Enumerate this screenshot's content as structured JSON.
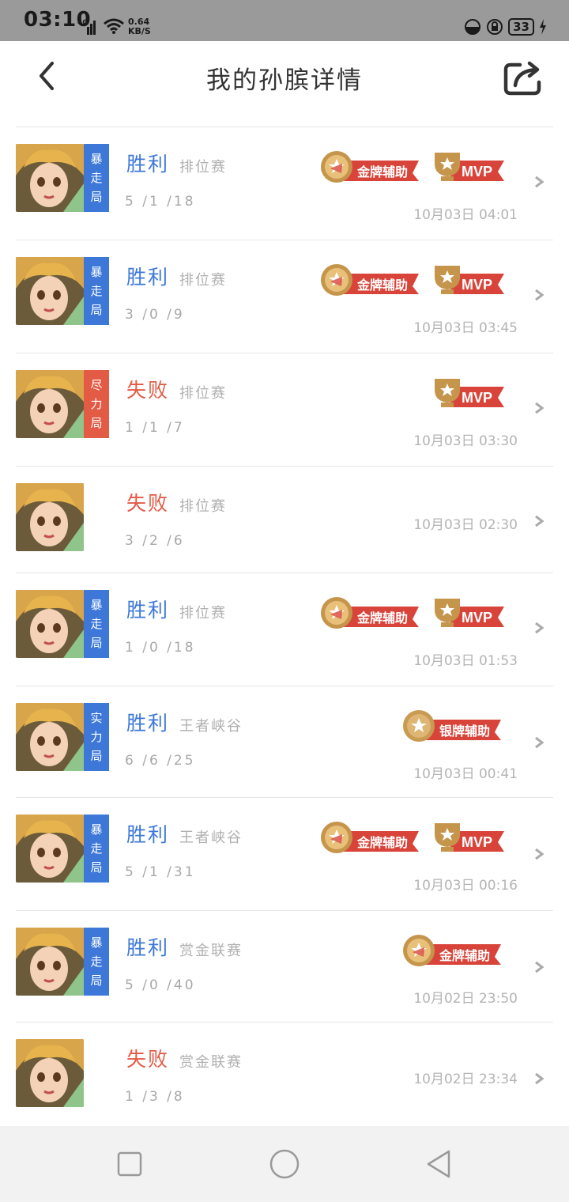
{
  "status_bar": {
    "time": "03:10",
    "network": "4G",
    "speed_value": "0.64",
    "speed_unit": "KB/S",
    "battery": "33"
  },
  "header": {
    "title": "我的孙膑详情"
  },
  "matches": [
    {
      "tag": [
        "暴",
        "走",
        "局"
      ],
      "tag_color": "#3d78d8",
      "result": "胜利",
      "result_type": "win",
      "mode": "排位赛",
      "kda": "5 /1 /18",
      "time": "10月03日 04:01",
      "badges": [
        "金牌辅助",
        "MVP"
      ]
    },
    {
      "tag": [
        "暴",
        "走",
        "局"
      ],
      "tag_color": "#3d78d8",
      "result": "胜利",
      "result_type": "win",
      "mode": "排位赛",
      "kda": "3 /0 /9",
      "time": "10月03日 03:45",
      "badges": [
        "金牌辅助",
        "MVP"
      ]
    },
    {
      "tag": [
        "尽",
        "力",
        "局"
      ],
      "tag_color": "#e35a45",
      "result": "失败",
      "result_type": "lose",
      "mode": "排位赛",
      "kda": "1 /1 /7",
      "time": "10月03日 03:30",
      "badges": [
        "MVP"
      ]
    },
    {
      "tag": [],
      "tag_color": "",
      "result": "失败",
      "result_type": "lose",
      "mode": "排位赛",
      "kda": "3 /2 /6",
      "time": "10月03日 02:30",
      "badges": []
    },
    {
      "tag": [
        "暴",
        "走",
        "局"
      ],
      "tag_color": "#3d78d8",
      "result": "胜利",
      "result_type": "win",
      "mode": "排位赛",
      "kda": "1 /0 /18",
      "time": "10月03日 01:53",
      "badges": [
        "金牌辅助",
        "MVP"
      ]
    },
    {
      "tag": [
        "实",
        "力",
        "局"
      ],
      "tag_color": "#3d78d8",
      "result": "胜利",
      "result_type": "win",
      "mode": "王者峡谷",
      "kda": "6 /6 /25",
      "time": "10月03日 00:41",
      "badges": [
        "银牌辅助"
      ]
    },
    {
      "tag": [
        "暴",
        "走",
        "局"
      ],
      "tag_color": "#3d78d8",
      "result": "胜利",
      "result_type": "win",
      "mode": "王者峡谷",
      "kda": "5 /1 /31",
      "time": "10月03日 00:16",
      "badges": [
        "金牌辅助",
        "MVP"
      ]
    },
    {
      "tag": [
        "暴",
        "走",
        "局"
      ],
      "tag_color": "#3d78d8",
      "result": "胜利",
      "result_type": "win",
      "mode": "赏金联赛",
      "kda": "5 /0 /40",
      "time": "10月02日 23:50",
      "badges": [
        "金牌辅助"
      ]
    },
    {
      "tag": [],
      "tag_color": "",
      "result": "失败",
      "result_type": "lose",
      "mode": "赏金联赛",
      "kda": "1 /3 /8",
      "time": "10月02日 23:34",
      "badges": []
    }
  ]
}
